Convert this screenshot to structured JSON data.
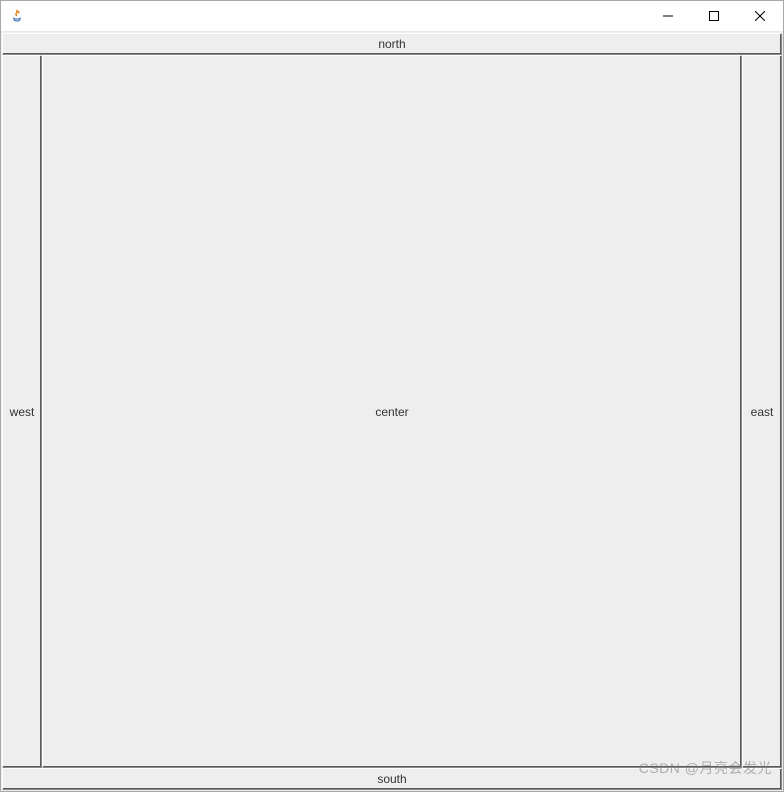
{
  "window": {
    "title": ""
  },
  "layout": {
    "north": "north",
    "south": "south",
    "west": "west",
    "east": "east",
    "center": "center"
  },
  "watermark": "CSDN @月亮会发光"
}
